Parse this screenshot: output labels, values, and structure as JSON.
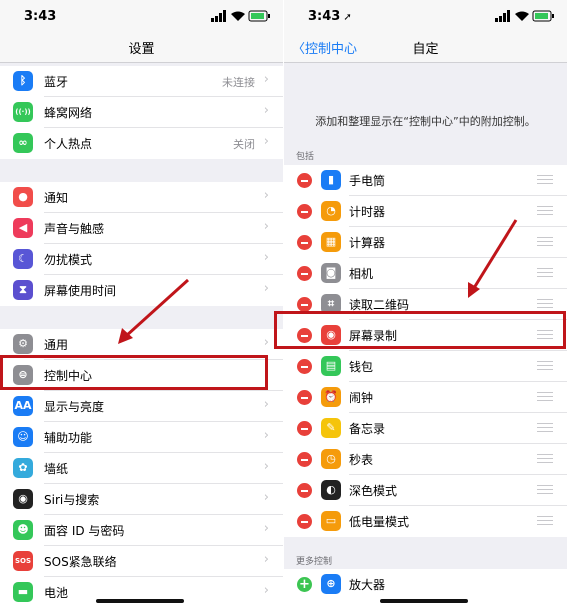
{
  "left": {
    "time": "3:43",
    "title": "设置",
    "group1": [
      {
        "label": "蓝牙",
        "value": "未连接",
        "icon": "bluetooth-icon",
        "color": "#1a7cf5",
        "glyph": "ᛒ"
      },
      {
        "label": "蜂窝网络",
        "value": "",
        "icon": "cellular-icon",
        "color": "#34c759",
        "glyph": "((·))"
      },
      {
        "label": "个人热点",
        "value": "关闭",
        "icon": "hotspot-icon",
        "color": "#34c759",
        "glyph": "∞"
      }
    ],
    "group2": [
      {
        "label": "通知",
        "icon": "notifications-icon",
        "color": "#f14d4a",
        "glyph": "●"
      },
      {
        "label": "声音与触感",
        "icon": "sound-icon",
        "color": "#ee3b5b",
        "glyph": "◀"
      },
      {
        "label": "勿扰模式",
        "icon": "do-not-disturb-icon",
        "color": "#5856d6",
        "glyph": "☾"
      },
      {
        "label": "屏幕使用时间",
        "icon": "screen-time-icon",
        "color": "#5b4fcf",
        "glyph": "⧗"
      }
    ],
    "group3": [
      {
        "label": "通用",
        "icon": "general-icon",
        "color": "#8e8e93",
        "glyph": "⚙"
      },
      {
        "label": "控制中心",
        "icon": "control-center-icon",
        "color": "#8e8e93",
        "glyph": "⊜"
      },
      {
        "label": "显示与亮度",
        "icon": "display-icon",
        "color": "#1a7cf5",
        "glyph": "AA"
      },
      {
        "label": "辅助功能",
        "icon": "accessibility-icon",
        "color": "#1a7cf5",
        "glyph": "☺"
      },
      {
        "label": "墙纸",
        "icon": "wallpaper-icon",
        "color": "#34aadc",
        "glyph": "✿"
      },
      {
        "label": "Siri与搜索",
        "icon": "siri-icon",
        "color": "#222222",
        "glyph": "◉"
      },
      {
        "label": "面容 ID 与密码",
        "icon": "face-id-icon",
        "color": "#34c759",
        "glyph": "☻"
      },
      {
        "label": "SOS紧急联络",
        "icon": "sos-icon",
        "color": "#e8403a",
        "glyph": "SOS"
      },
      {
        "label": "电池",
        "icon": "battery-icon",
        "color": "#34c759",
        "glyph": "▬"
      }
    ]
  },
  "right": {
    "time": "3:43",
    "back_label": "控制中心",
    "title": "自定",
    "description": "添加和整理显示在“控制中心”中的附加控制。",
    "section_include": "包括",
    "section_more": "更多控制",
    "included": [
      {
        "label": "手电筒",
        "icon": "flashlight-icon",
        "color": "#1a7cf5",
        "glyph": "▮"
      },
      {
        "label": "计时器",
        "icon": "timer-icon",
        "color": "#f59b0b",
        "glyph": "◔"
      },
      {
        "label": "计算器",
        "icon": "calculator-icon",
        "color": "#f59b0b",
        "glyph": "▦"
      },
      {
        "label": "相机",
        "icon": "camera-icon",
        "color": "#8e8e93",
        "glyph": "◙"
      },
      {
        "label": "读取二维码",
        "icon": "qr-code-icon",
        "color": "#8e8e93",
        "glyph": "⌗"
      },
      {
        "label": "屏幕录制",
        "icon": "screen-recording-icon",
        "color": "#e8403a",
        "glyph": "◉"
      },
      {
        "label": "钱包",
        "icon": "wallet-icon",
        "color": "#34c759",
        "glyph": "▤"
      },
      {
        "label": "闹钟",
        "icon": "alarm-icon",
        "color": "#f59b0b",
        "glyph": "⏰"
      },
      {
        "label": "备忘录",
        "icon": "notes-icon",
        "color": "#f5c40b",
        "glyph": "✎"
      },
      {
        "label": "秒表",
        "icon": "stopwatch-icon",
        "color": "#f59b0b",
        "glyph": "◷"
      },
      {
        "label": "深色模式",
        "icon": "dark-mode-icon",
        "color": "#222222",
        "glyph": "◐"
      },
      {
        "label": "低电量模式",
        "icon": "low-power-icon",
        "color": "#f59b0b",
        "glyph": "▭"
      }
    ],
    "more": [
      {
        "label": "放大器",
        "icon": "magnifier-icon",
        "color": "#1a7cf5",
        "glyph": "⊕"
      }
    ]
  },
  "colors": {
    "highlight": "#c0151a",
    "accent": "#1a7cf5"
  }
}
